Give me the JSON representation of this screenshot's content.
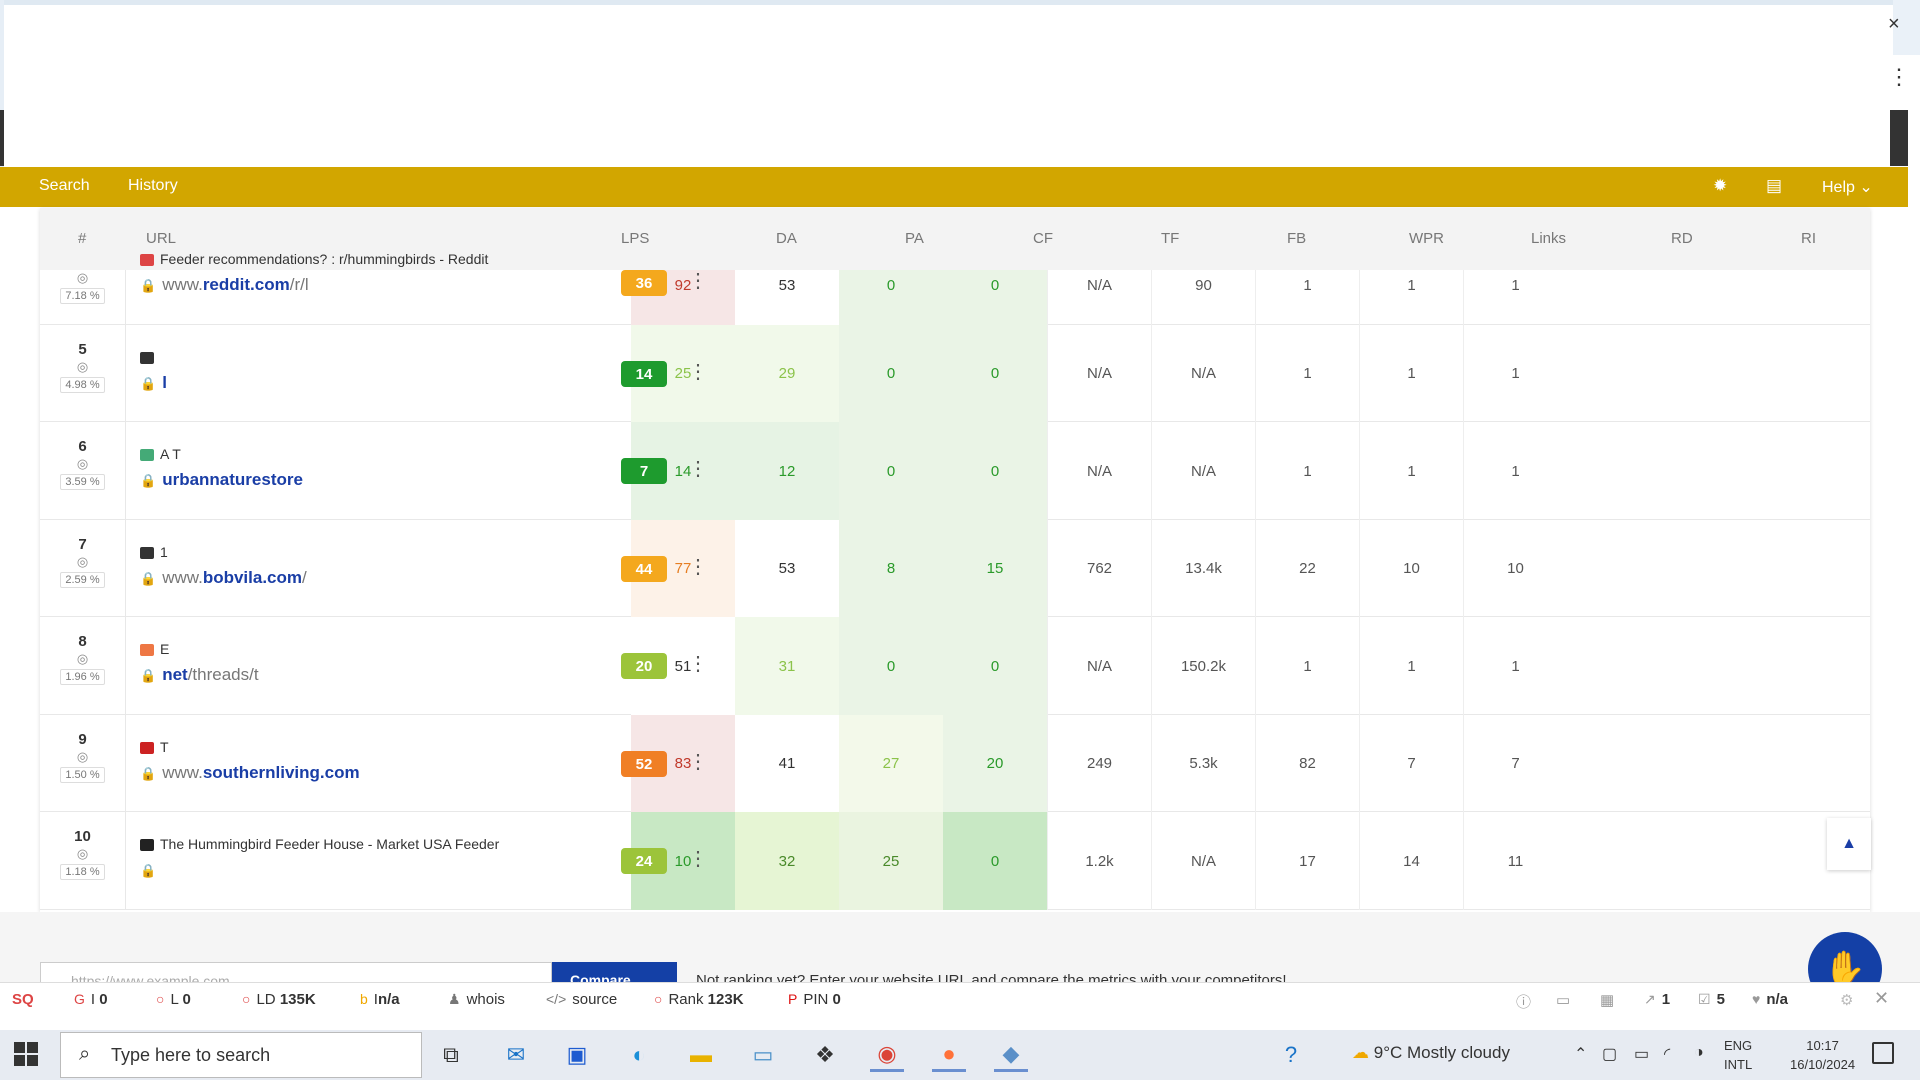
{
  "browser": {
    "close_glyph": "×",
    "menu_glyph": "⋮"
  },
  "toolbar": {
    "tabs": [
      "Search",
      "History"
    ],
    "icons": [
      "gear-icon",
      "keyboard-icon"
    ],
    "help_label": "Help",
    "help_chevron": "⌄",
    "color": "#d2a600"
  },
  "table": {
    "headers": [
      "#",
      "URL",
      "LPS",
      "DA",
      "PA",
      "CF",
      "TF",
      "FB",
      "WPR",
      "Links",
      "RD",
      "RI"
    ],
    "rows": [
      {
        "num": "",
        "pct": "7.18 %",
        "title": "Feeder recommendations? : r/hummingbirds - Reddit",
        "url_prefix": "www.",
        "url_domain": "reddit.com",
        "url_path": "/r/l",
        "lps": "36",
        "lps_color": "#f4a81d",
        "metrics": [
          "92",
          "53",
          "0",
          "0",
          "N/A",
          "90",
          "1",
          "1",
          "1"
        ]
      },
      {
        "num": "5",
        "pct": "4.98 %",
        "title": "",
        "url_prefix": "",
        "url_domain": "l",
        "url_path": "",
        "lps": "14",
        "lps_color": "#1e9b2e",
        "metrics": [
          "25",
          "29",
          "0",
          "0",
          "N/A",
          "N/A",
          "1",
          "1",
          "1"
        ]
      },
      {
        "num": "6",
        "pct": "3.59 %",
        "title": "A T",
        "url_prefix": "",
        "url_domain": "urbannaturestore",
        "url_path": "",
        "lps": "7",
        "lps_color": "#1e9b2e",
        "metrics": [
          "14",
          "12",
          "0",
          "0",
          "N/A",
          "N/A",
          "1",
          "1",
          "1"
        ]
      },
      {
        "num": "7",
        "pct": "2.59 %",
        "title": "1",
        "url_prefix": "www.",
        "url_domain": "bobvila.com",
        "url_path": "/",
        "lps": "44",
        "lps_color": "#f4a81d",
        "metrics": [
          "77",
          "53",
          "8",
          "15",
          "762",
          "13.4k",
          "22",
          "10",
          "10"
        ]
      },
      {
        "num": "8",
        "pct": "1.96 %",
        "title": "E",
        "url_prefix": "",
        "url_domain": "net",
        "url_path": "/threads/t",
        "lps": "20",
        "lps_color": "#9cc43a",
        "metrics": [
          "51",
          "31",
          "0",
          "0",
          "N/A",
          "150.2k",
          "1",
          "1",
          "1"
        ]
      },
      {
        "num": "9",
        "pct": "1.50 %",
        "title": "T",
        "url_prefix": "www.",
        "url_domain": "southernliving.com",
        "url_path": "",
        "lps": "52",
        "lps_color": "#f07f25",
        "metrics": [
          "83",
          "41",
          "27",
          "20",
          "249",
          "5.3k",
          "82",
          "7",
          "7"
        ]
      },
      {
        "num": "10",
        "pct": "1.18 %",
        "title": "The Hummingbird Feeder House - Market USA Feeder",
        "url_prefix": "",
        "url_domain": "",
        "url_path": "",
        "lps": "24",
        "lps_color": "#9cc43a",
        "metrics": [
          "10",
          "32",
          "25",
          "0",
          "1.2k",
          "N/A",
          "17",
          "14",
          "11"
        ]
      }
    ]
  },
  "compare": {
    "placeholder": "https://www.example.com",
    "button_label": "Compare",
    "prompt": "Not ranking yet? Enter your website URL and compare the metrics with your competitors!"
  },
  "seoquake": {
    "items": [
      {
        "icon": "G",
        "label": "I",
        "value": "0"
      },
      {
        "icon": "○",
        "label": "L",
        "value": "0"
      },
      {
        "icon": "○",
        "label": "LD",
        "value": "135K"
      },
      {
        "icon": "b",
        "label": "I",
        "value": "n/a"
      },
      {
        "icon": "♟",
        "label": "whois",
        "value": ""
      },
      {
        "icon": "</>",
        "label": "source",
        "value": ""
      },
      {
        "icon": "○",
        "label": "Rank",
        "value": "123K"
      },
      {
        "icon": "P",
        "label": "PIN",
        "value": "0"
      }
    ],
    "right_items": [
      {
        "label": "",
        "value": "1"
      },
      {
        "label": "",
        "value": "5"
      },
      {
        "label": "",
        "value": "n/a"
      }
    ]
  },
  "taskbar": {
    "search_placeholder": "Type here to search",
    "weather": "9°C  Mostly cloudy",
    "lang_top": "ENG",
    "lang_bottom": "INTL",
    "time": "10:17",
    "date": "16/10/2024"
  }
}
